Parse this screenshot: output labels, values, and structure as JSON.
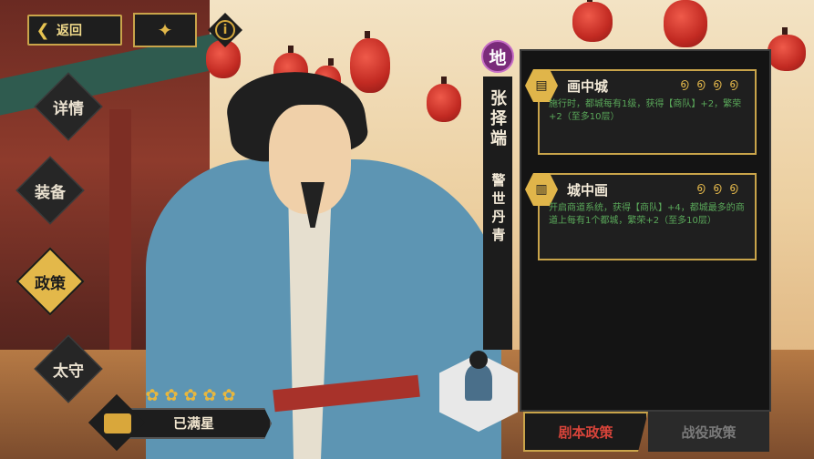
{
  "header": {
    "back_label": "返回",
    "info_label": "i"
  },
  "nav": {
    "items": [
      {
        "label": "详情",
        "active": false
      },
      {
        "label": "装备",
        "active": false
      },
      {
        "label": "政策",
        "active": true
      },
      {
        "label": "太守",
        "active": false
      }
    ]
  },
  "hero": {
    "rarity": "地",
    "name": "张择端",
    "title": "警世丹青",
    "star_count": 5,
    "star_status": "已满星"
  },
  "policies": [
    {
      "name": "画中城",
      "level_icons": 4,
      "desc": "施行时，都城每有1级，获得【商队】+2，繁荣+2（至多10层）"
    },
    {
      "name": "城中画",
      "level_icons": 3,
      "desc": "开启商道系统，获得【商队】+4，都城最多的商道上每有1个都城，繁荣+2（至多10层）"
    }
  ],
  "tabs": [
    {
      "label": "剧本政策",
      "active": true
    },
    {
      "label": "战役政策",
      "active": false
    }
  ],
  "colors": {
    "accent_gold": "#c9a44a",
    "active_tab_text": "#d8443a",
    "policy_desc": "#5aa85a",
    "rarity_purple": "#7a2b7a"
  }
}
